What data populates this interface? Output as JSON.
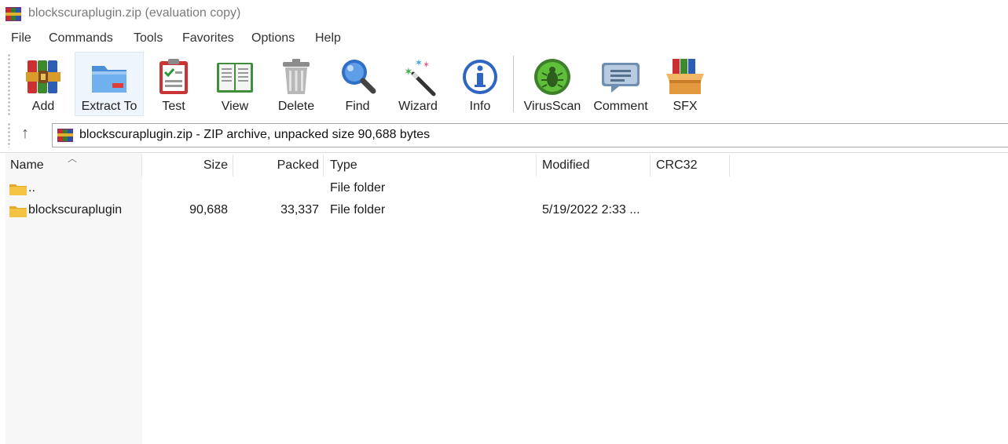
{
  "window": {
    "title": "blockscuraplugin.zip (evaluation copy)"
  },
  "menu": [
    "File",
    "Commands",
    "Tools",
    "Favorites",
    "Options",
    "Help"
  ],
  "toolbar": [
    {
      "label": "Add",
      "icon": "add-archive-icon"
    },
    {
      "label": "Extract To",
      "icon": "extract-folder-icon"
    },
    {
      "label": "Test",
      "icon": "test-clipboard-icon"
    },
    {
      "label": "View",
      "icon": "view-book-icon"
    },
    {
      "label": "Delete",
      "icon": "trash-icon"
    },
    {
      "label": "Find",
      "icon": "magnifier-icon"
    },
    {
      "label": "Wizard",
      "icon": "magic-wand-icon"
    },
    {
      "label": "Info",
      "icon": "info-icon"
    },
    {
      "label": "VirusScan",
      "icon": "virus-bug-icon"
    },
    {
      "label": "Comment",
      "icon": "comment-bubble-icon"
    },
    {
      "label": "SFX",
      "icon": "sfx-box-icon"
    }
  ],
  "address": {
    "up_glyph": "↑",
    "path": "blockscuraplugin.zip - ZIP archive, unpacked size 90,688 bytes"
  },
  "columns": [
    "Name",
    "Size",
    "Packed",
    "Type",
    "Modified",
    "CRC32"
  ],
  "files": [
    {
      "name": "..",
      "size": "",
      "packed": "",
      "type": "File folder",
      "modified": "",
      "crc32": ""
    },
    {
      "name": "blockscuraplugin",
      "size": "90,688",
      "packed": "33,337",
      "type": "File folder",
      "modified": "5/19/2022 2:33 ...",
      "crc32": ""
    }
  ],
  "colors": {
    "folder": "#f5c343",
    "folder_dark": "#e3a92a",
    "active_button": "#eef5fc"
  }
}
